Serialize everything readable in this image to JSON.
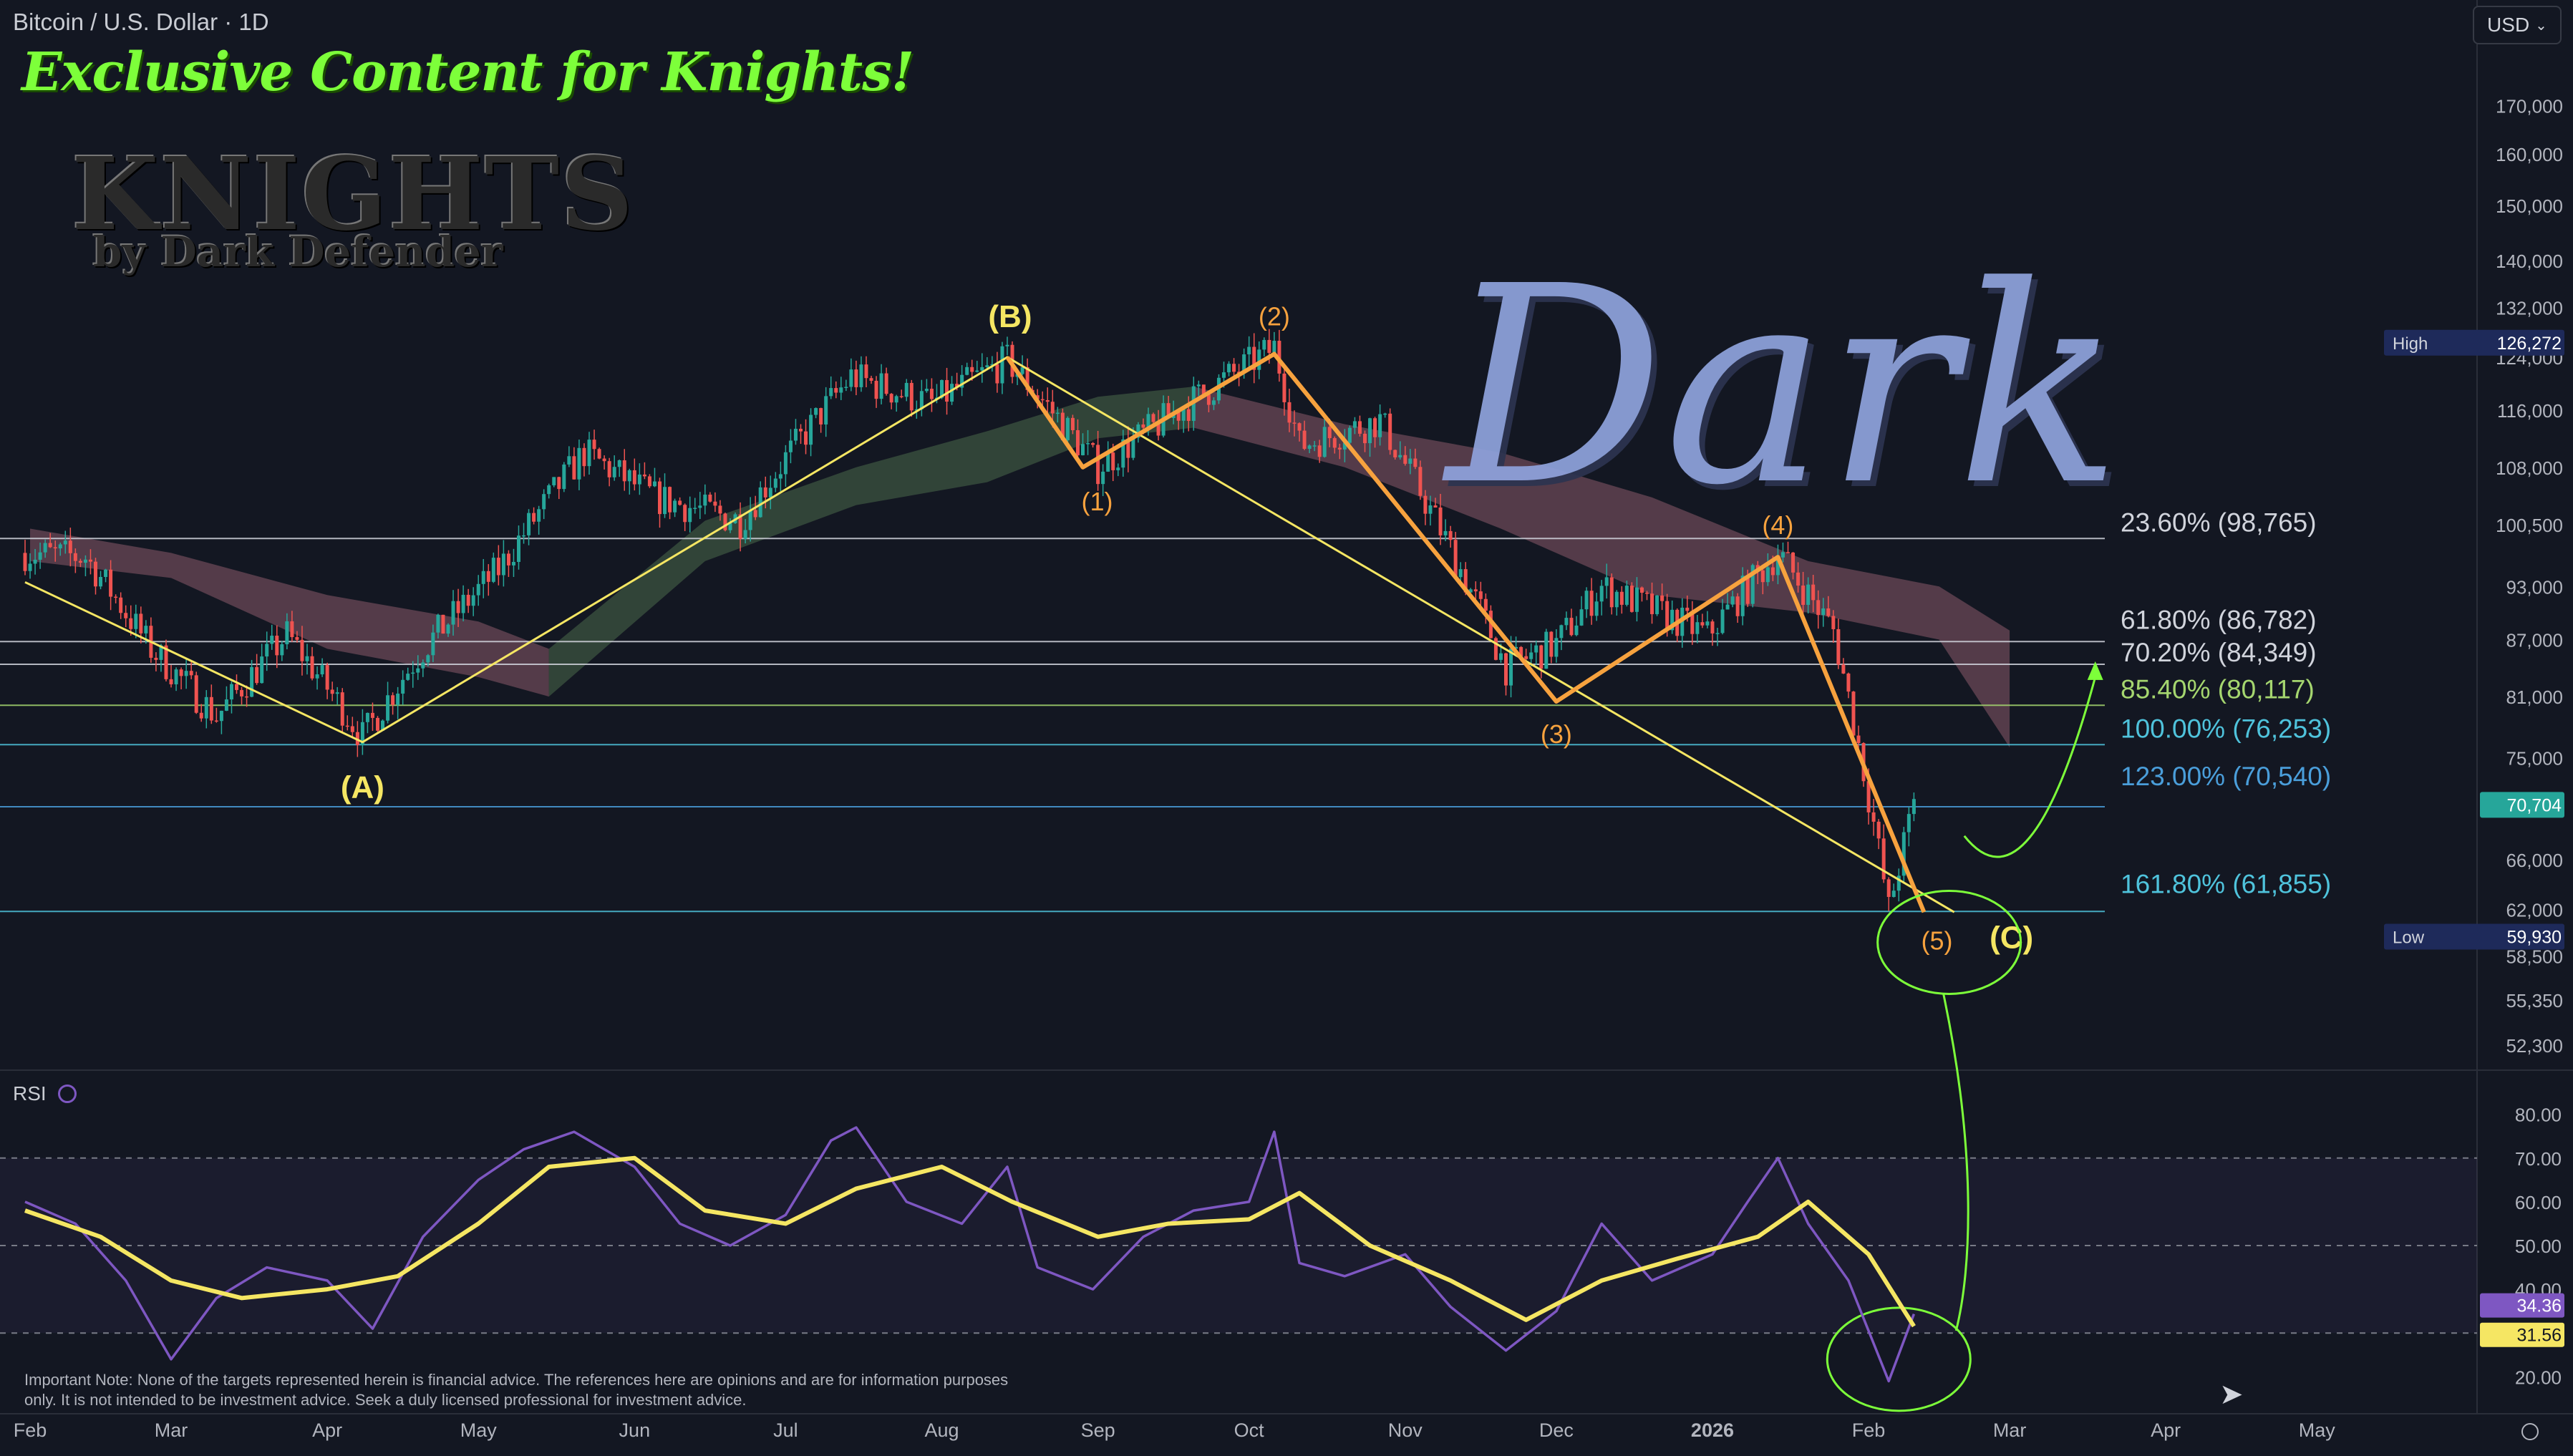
{
  "header": {
    "title": "Bitcoin / U.S. Dollar · 1D",
    "currency": "USD"
  },
  "promo": {
    "banner": "Exclusive Content for Knights!",
    "logo_main": "KNIGHTS",
    "logo_sub": "by Dark Defender"
  },
  "watermark": "Dark",
  "rsi_label": "RSI",
  "note": "Important Note: None of the targets represented herein is financial advice. The references here are opinions and are for information purposes only. It is not intended to be investment advice. Seek a duly licensed professional for investment advice.",
  "colors": {
    "background": "#131722",
    "wave_abc": "#f5e663",
    "wave_impulse": "#f7a23e",
    "up_candle": "#26a69a",
    "down_candle": "#ef5350",
    "rsi": "#7e57c2",
    "rsi_ma": "#f5e663",
    "annotation": "#7dff3a"
  },
  "chart_data": [
    {
      "type": "candlestick",
      "title": "Bitcoin / U.S. Dollar · 1D",
      "x_axis": {
        "labels": [
          {
            "date": "2025-02-01",
            "text": "Feb"
          },
          {
            "date": "2025-03-01",
            "text": "Mar"
          },
          {
            "date": "2025-04-01",
            "text": "Apr"
          },
          {
            "date": "2025-05-01",
            "text": "May"
          },
          {
            "date": "2025-06-01",
            "text": "Jun"
          },
          {
            "date": "2025-07-01",
            "text": "Jul"
          },
          {
            "date": "2025-08-01",
            "text": "Aug"
          },
          {
            "date": "2025-09-01",
            "text": "Sep"
          },
          {
            "date": "2025-10-01",
            "text": "Oct"
          },
          {
            "date": "2025-11-01",
            "text": "Nov"
          },
          {
            "date": "2025-12-01",
            "text": "Dec"
          },
          {
            "date": "2026-01-01",
            "text": "2026"
          },
          {
            "date": "2026-02-01",
            "text": "Feb"
          },
          {
            "date": "2026-03-01",
            "text": "Mar"
          },
          {
            "date": "2026-04-01",
            "text": "Apr"
          },
          {
            "date": "2026-05-01",
            "text": "May"
          }
        ]
      },
      "y_axis": {
        "scale": "log",
        "ticks": [
          52300,
          55350,
          58500,
          62000,
          66000,
          70704,
          75000,
          81000,
          87000,
          93000,
          100500,
          108000,
          116000,
          124000,
          132000,
          140000,
          150000,
          160000,
          170000
        ],
        "tick_labels": [
          "52,300",
          "55,350",
          "58,500",
          "62,000",
          "66,000",
          "70,704",
          "75,000",
          "81,000",
          "87,000",
          "93,000",
          "100,500",
          "108,000",
          "116,000",
          "124,000",
          "132,000",
          "140,000",
          "150,000",
          "160,000",
          "170,000"
        ],
        "range": [
          50000,
          180000
        ],
        "ticks_hidden": [
          70704
        ]
      },
      "price_points": [
        [
          "2025-01-31",
          97000
        ],
        [
          "2025-02-12",
          96500
        ],
        [
          "2025-02-25",
          86000
        ],
        [
          "2025-03-10",
          79000
        ],
        [
          "2025-03-24",
          87500
        ],
        [
          "2025-04-08",
          77000
        ],
        [
          "2025-04-20",
          86000
        ],
        [
          "2025-05-05",
          95000
        ],
        [
          "2025-05-22",
          110000
        ],
        [
          "2025-06-05",
          104000
        ],
        [
          "2025-06-22",
          101000
        ],
        [
          "2025-07-14",
          121000
        ],
        [
          "2025-07-30",
          117000
        ],
        [
          "2025-08-14",
          123500
        ],
        [
          "2025-09-01",
          108000
        ],
        [
          "2025-09-18",
          116500
        ],
        [
          "2025-10-06",
          125500
        ],
        [
          "2025-10-11",
          111000
        ],
        [
          "2025-10-27",
          114500
        ],
        [
          "2025-11-21",
          84000
        ],
        [
          "2025-12-01",
          86500
        ],
        [
          "2025-12-10",
          93000
        ],
        [
          "2025-12-31",
          87500
        ],
        [
          "2026-01-14",
          97000
        ],
        [
          "2026-01-25",
          88000
        ],
        [
          "2026-02-05",
          62000
        ],
        [
          "2026-02-10",
          70704
        ]
      ],
      "current_price": {
        "value": 70704,
        "label": "70,704"
      },
      "high": {
        "label": "High",
        "value": 126272,
        "text": "126,272"
      },
      "low": {
        "label": "Low",
        "value": 59930,
        "text": "59,930"
      },
      "fib_levels": [
        {
          "pct": "23.60%",
          "value": 98765,
          "text": "23.60% (98,765)",
          "color": "#d1d4dc"
        },
        {
          "pct": "61.80%",
          "value": 86782,
          "text": "61.80% (86,782)",
          "color": "#d1d4dc"
        },
        {
          "pct": "70.20%",
          "value": 84349,
          "text": "70.20% (84,349)",
          "color": "#d1d4dc"
        },
        {
          "pct": "85.40%",
          "value": 80117,
          "text": "85.40% (80,117)",
          "color": "#a5d66f"
        },
        {
          "pct": "100.00%",
          "value": 76253,
          "text": "100.00% (76,253)",
          "color": "#4fc3dc"
        },
        {
          "pct": "123.00%",
          "value": 70540,
          "text": "123.00% (70,540)",
          "color": "#4a9eda"
        },
        {
          "pct": "161.80%",
          "value": 61855,
          "text": "161.80% (61,855)",
          "color": "#4fc3dc"
        }
      ],
      "wave_abc": [
        {
          "date": "2025-01-31",
          "price": 93500,
          "label": ""
        },
        {
          "date": "2025-04-08",
          "price": 76500,
          "label": "(A)"
        },
        {
          "date": "2025-08-14",
          "price": 124000,
          "label": "(B)"
        },
        {
          "date": "2026-02-18",
          "price": 61800,
          "label": "(C)"
        }
      ],
      "wave_impulse": [
        {
          "date": "2025-08-14",
          "price": 124000,
          "label": ""
        },
        {
          "date": "2025-08-29",
          "price": 108000,
          "label": "(1)"
        },
        {
          "date": "2025-10-06",
          "price": 124500,
          "label": "(2)"
        },
        {
          "date": "2025-12-01",
          "price": 80500,
          "label": "(3)"
        },
        {
          "date": "2026-01-14",
          "price": 96500,
          "label": "(4)"
        },
        {
          "date": "2026-02-12",
          "price": 61800,
          "label": "(5)"
        }
      ],
      "cloud_bands": [
        {
          "color": "#8a5a6a",
          "points": [
            [
              "2025-02-01",
              96000,
              100000
            ],
            [
              "2025-03-01",
              94000,
              97000
            ],
            [
              "2025-04-01",
              86000,
              92000
            ],
            [
              "2025-05-01",
              83000,
              89000
            ],
            [
              "2025-05-15",
              81000,
              86000
            ]
          ]
        },
        {
          "color": "#4a6a4a",
          "points": [
            [
              "2025-05-15",
              81000,
              86000
            ],
            [
              "2025-06-15",
              96000,
              101000
            ],
            [
              "2025-07-15",
              103000,
              108000
            ],
            [
              "2025-08-10",
              106000,
              113000
            ],
            [
              "2025-09-01",
              112000,
              118000
            ],
            [
              "2025-09-20",
              113500,
              119500
            ]
          ]
        },
        {
          "color": "#8a5a6a",
          "points": [
            [
              "2025-09-20",
              113500,
              119500
            ],
            [
              "2025-10-20",
              108000,
              114000
            ],
            [
              "2025-11-20",
              100000,
              110000
            ],
            [
              "2025-12-20",
              92000,
              104000
            ],
            [
              "2026-01-20",
              90000,
              96000
            ],
            [
              "2026-02-15",
              87000,
              93000
            ],
            [
              "2026-03-01",
              76000,
              88000
            ]
          ]
        }
      ],
      "projection": [
        [
          "2026-02-20",
          68000
        ],
        [
          "2026-03-05",
          66500
        ],
        [
          "2026-03-18",
          83000
        ]
      ]
    },
    {
      "type": "line",
      "title": "RSI",
      "y_axis": {
        "ticks": [
          20,
          30,
          40,
          50,
          60,
          70,
          80
        ],
        "tick_labels": [
          "20.00",
          "30.00",
          "40.00",
          "50.00",
          "60.00",
          "70.00",
          "80.00"
        ],
        "range": [
          14,
          86
        ],
        "dashed_levels": [
          70,
          50,
          30
        ]
      },
      "series": [
        {
          "name": "RSI",
          "color": "#7e57c2",
          "current": {
            "value": 34.36,
            "label": "34.36"
          },
          "points": [
            [
              "2025-01-31",
              60
            ],
            [
              "2025-02-10",
              55
            ],
            [
              "2025-02-20",
              42
            ],
            [
              "2025-03-01",
              24
            ],
            [
              "2025-03-10",
              38
            ],
            [
              "2025-03-20",
              45
            ],
            [
              "2025-04-01",
              42
            ],
            [
              "2025-04-10",
              31
            ],
            [
              "2025-04-20",
              52
            ],
            [
              "2025-05-01",
              65
            ],
            [
              "2025-05-10",
              72
            ],
            [
              "2025-05-20",
              76
            ],
            [
              "2025-06-01",
              68
            ],
            [
              "2025-06-10",
              55
            ],
            [
              "2025-06-20",
              50
            ],
            [
              "2025-07-01",
              57
            ],
            [
              "2025-07-10",
              74
            ],
            [
              "2025-07-15",
              77
            ],
            [
              "2025-07-25",
              60
            ],
            [
              "2025-08-05",
              55
            ],
            [
              "2025-08-14",
              68
            ],
            [
              "2025-08-20",
              45
            ],
            [
              "2025-08-31",
              40
            ],
            [
              "2025-09-10",
              52
            ],
            [
              "2025-09-20",
              58
            ],
            [
              "2025-10-01",
              60
            ],
            [
              "2025-10-06",
              76
            ],
            [
              "2025-10-11",
              46
            ],
            [
              "2025-10-20",
              43
            ],
            [
              "2025-11-01",
              48
            ],
            [
              "2025-11-10",
              36
            ],
            [
              "2025-11-21",
              26
            ],
            [
              "2025-12-01",
              35
            ],
            [
              "2025-12-10",
              55
            ],
            [
              "2025-12-20",
              42
            ],
            [
              "2026-01-01",
              48
            ],
            [
              "2026-01-08",
              60
            ],
            [
              "2026-01-14",
              70
            ],
            [
              "2026-01-20",
              55
            ],
            [
              "2026-01-28",
              42
            ],
            [
              "2026-02-05",
              19
            ],
            [
              "2026-02-10",
              34.36
            ]
          ]
        },
        {
          "name": "RSI-based MA",
          "color": "#f5e663",
          "current": {
            "value": 31.56,
            "label": "31.56"
          },
          "points": [
            [
              "2025-01-31",
              58
            ],
            [
              "2025-02-15",
              52
            ],
            [
              "2025-03-01",
              42
            ],
            [
              "2025-03-15",
              38
            ],
            [
              "2025-04-01",
              40
            ],
            [
              "2025-04-15",
              43
            ],
            [
              "2025-05-01",
              55
            ],
            [
              "2025-05-15",
              68
            ],
            [
              "2025-06-01",
              70
            ],
            [
              "2025-06-15",
              58
            ],
            [
              "2025-07-01",
              55
            ],
            [
              "2025-07-15",
              63
            ],
            [
              "2025-08-01",
              68
            ],
            [
              "2025-08-15",
              60
            ],
            [
              "2025-09-01",
              52
            ],
            [
              "2025-09-15",
              55
            ],
            [
              "2025-10-01",
              56
            ],
            [
              "2025-10-11",
              62
            ],
            [
              "2025-10-25",
              50
            ],
            [
              "2025-11-10",
              42
            ],
            [
              "2025-11-25",
              33
            ],
            [
              "2025-12-10",
              42
            ],
            [
              "2025-12-25",
              47
            ],
            [
              "2026-01-10",
              52
            ],
            [
              "2026-01-20",
              60
            ],
            [
              "2026-02-01",
              48
            ],
            [
              "2026-02-10",
              31.56
            ]
          ]
        }
      ]
    }
  ]
}
